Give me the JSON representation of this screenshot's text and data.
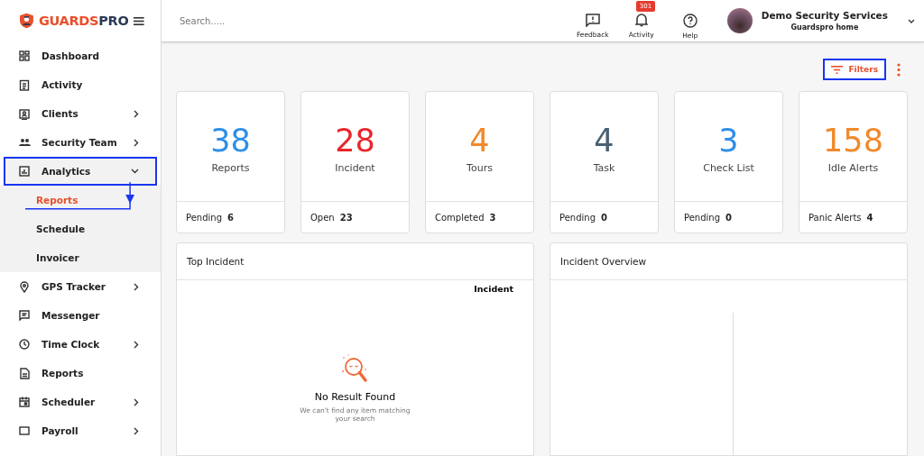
{
  "brand": {
    "name_part_1": "GUARDS",
    "name_part_2": "PRO"
  },
  "sidebar": {
    "items": [
      {
        "label": "Dashboard",
        "kind": "link",
        "selected": false,
        "annotated": false
      },
      {
        "label": "Activity",
        "kind": "link",
        "selected": false,
        "annotated": false
      },
      {
        "label": "Clients",
        "kind": "menu",
        "expanded": false,
        "selected": false,
        "annotated": false
      },
      {
        "label": "Security Team",
        "kind": "menu",
        "expanded": false,
        "selected": false,
        "annotated": false
      },
      {
        "label": "Analytics",
        "kind": "menu",
        "expanded": true,
        "selected": false,
        "annotated": true,
        "children": [
          {
            "label": "Reports",
            "selected": true,
            "annotated": true
          },
          {
            "label": "Schedule",
            "selected": false,
            "annotated": false
          },
          {
            "label": "Invoicer",
            "selected": false,
            "annotated": false
          }
        ]
      },
      {
        "label": "GPS Tracker",
        "kind": "menu",
        "expanded": false,
        "selected": false,
        "annotated": false
      },
      {
        "label": "Messenger",
        "kind": "link",
        "selected": false,
        "annotated": false
      },
      {
        "label": "Time Clock",
        "kind": "menu",
        "expanded": false,
        "selected": false,
        "annotated": false
      },
      {
        "label": "Reports",
        "kind": "link",
        "selected": false,
        "annotated": false
      },
      {
        "label": "Scheduler",
        "kind": "menu",
        "expanded": false,
        "selected": false,
        "annotated": false
      },
      {
        "label": "Payroll",
        "kind": "menu",
        "expanded": false,
        "selected": false,
        "annotated": false
      }
    ]
  },
  "topbar": {
    "search": {
      "placeholder": "Search....."
    },
    "actions": [
      {
        "label": "Feedback"
      },
      {
        "label": "Activity",
        "badge": "301"
      },
      {
        "label": "Help"
      }
    ],
    "profile": {
      "name": "Demo Security Services",
      "subtitle": "Guardspro home"
    }
  },
  "toolbar": {
    "filters": {
      "label": "Filters",
      "annotated": true
    }
  },
  "stats": [
    {
      "value": "38",
      "label": "Reports",
      "color": "#2f8fe6",
      "footer_label": "Pending",
      "footer_value": "6"
    },
    {
      "value": "28",
      "label": "Incident",
      "color": "#e8262b",
      "footer_label": "Open",
      "footer_value": "23"
    },
    {
      "value": "4",
      "label": "Tours",
      "color": "#f0892b",
      "footer_label": "Completed",
      "footer_value": "3"
    },
    {
      "value": "4",
      "label": "Task",
      "color": "#4a6072",
      "footer_label": "Pending",
      "footer_value": "0"
    },
    {
      "value": "3",
      "label": "Check List",
      "color": "#2f8fe6",
      "footer_label": "Pending",
      "footer_value": "0"
    },
    {
      "value": "158",
      "label": "Idle Alerts",
      "color": "#f0892b",
      "footer_label": "Panic Alerts",
      "footer_value": "4"
    }
  ],
  "panels": [
    {
      "title": "Top Incident",
      "kind": "empty",
      "legend": "Incident",
      "empty_title": "No Result Found",
      "empty_text": "We can't find any item matching your search"
    },
    {
      "title": "Incident Overview",
      "kind": "chart"
    }
  ]
}
